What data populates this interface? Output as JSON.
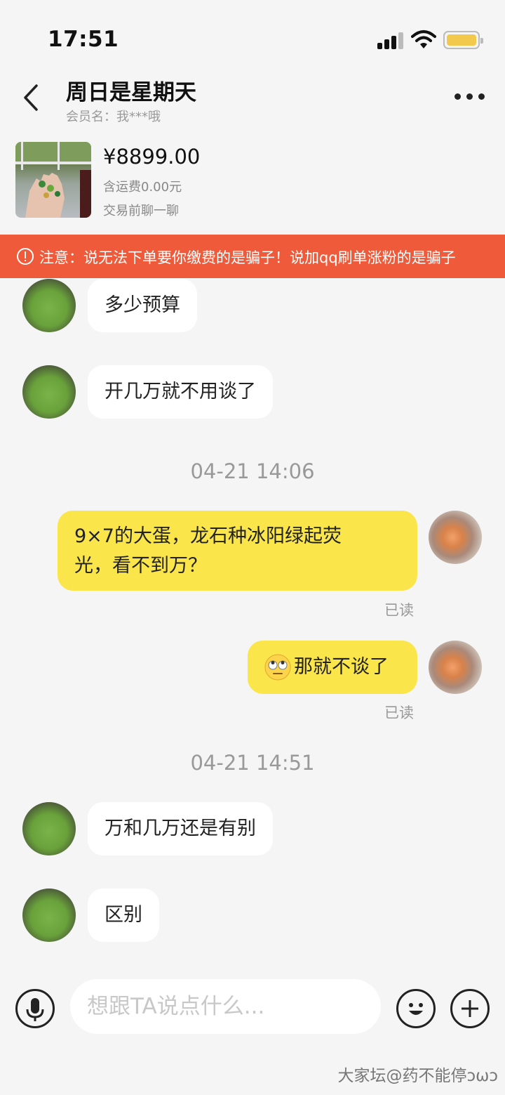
{
  "status_bar": {
    "time": "17:51"
  },
  "header": {
    "title": "周日是星期天",
    "member_label": "会员名：我***哦"
  },
  "product": {
    "price": "¥8899.00",
    "shipping": "含运费0.00元",
    "note": "交易前聊一聊"
  },
  "warning": {
    "text": "注意：说无法下单要你缴费的是骗子！说加qq刷单涨粉的是骗子"
  },
  "messages": [
    {
      "side": "left",
      "text": "多少预算"
    },
    {
      "side": "left",
      "text": "开几万就不用谈了"
    },
    {
      "type": "time",
      "text": "04-21 14:06"
    },
    {
      "side": "right",
      "lines": [
        "9×7的大蛋，龙石种冰阳绿起荧",
        "光，看不到万？"
      ],
      "read": "已读"
    },
    {
      "side": "right",
      "emoji": "eye-roll-emoji",
      "text": "那就不谈了",
      "read": "已读"
    },
    {
      "type": "time",
      "text": "04-21 14:51"
    },
    {
      "side": "left",
      "text": "万和几万还是有别"
    },
    {
      "side": "left",
      "text": "区别"
    }
  ],
  "input": {
    "placeholder": "想跟TA说点什么..."
  },
  "watermark": "大家坛@药不能停ↄωↄ",
  "colors": {
    "background": "#f5f5f5",
    "warning_bar": "#ee5a3a",
    "my_bubble": "#fae54a",
    "their_bubble": "#ffffff",
    "battery": "#f2c94c"
  },
  "icons": [
    "signal-icon",
    "wifi-icon",
    "battery-icon",
    "back-arrow-icon",
    "more-icon",
    "alert-circle-icon",
    "microphone-icon",
    "emoji-icon",
    "plus-icon"
  ]
}
